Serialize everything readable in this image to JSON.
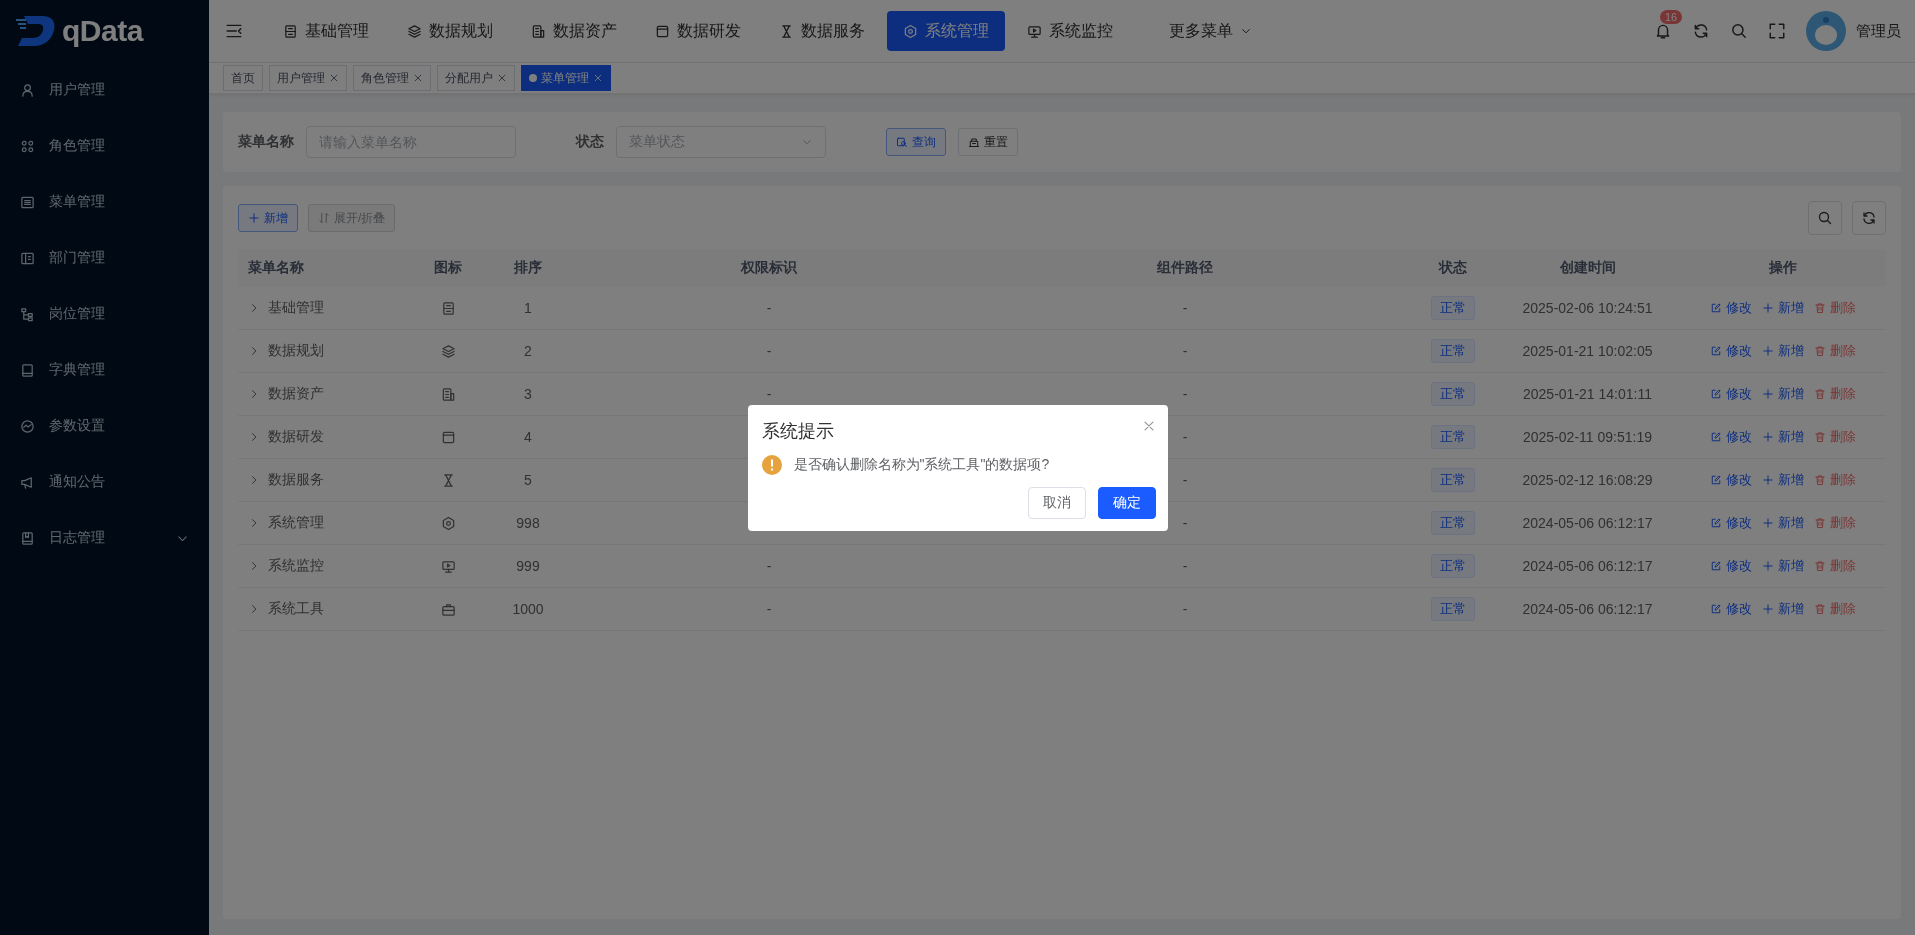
{
  "brand": {
    "name": "qData"
  },
  "sidebar": {
    "items": [
      {
        "label": "用户管理",
        "has_children": false
      },
      {
        "label": "角色管理",
        "has_children": false
      },
      {
        "label": "菜单管理",
        "has_children": false
      },
      {
        "label": "部门管理",
        "has_children": false
      },
      {
        "label": "岗位管理",
        "has_children": false
      },
      {
        "label": "字典管理",
        "has_children": false
      },
      {
        "label": "参数设置",
        "has_children": false
      },
      {
        "label": "通知公告",
        "has_children": false
      },
      {
        "label": "日志管理",
        "has_children": true
      }
    ]
  },
  "top_nav": {
    "items": [
      {
        "label": "基础管理",
        "selected": false
      },
      {
        "label": "数据规划",
        "selected": false
      },
      {
        "label": "数据资产",
        "selected": false
      },
      {
        "label": "数据研发",
        "selected": false
      },
      {
        "label": "数据服务",
        "selected": false
      },
      {
        "label": "系统管理",
        "selected": true
      },
      {
        "label": "系统监控",
        "selected": false
      }
    ],
    "more": "更多菜单"
  },
  "header_right": {
    "notification_count": "16",
    "user_name": "管理员"
  },
  "tabs": [
    {
      "label": "首页",
      "closable": false,
      "selected": false
    },
    {
      "label": "用户管理",
      "closable": true,
      "selected": false
    },
    {
      "label": "角色管理",
      "closable": true,
      "selected": false
    },
    {
      "label": "分配用户",
      "closable": true,
      "selected": false
    },
    {
      "label": "菜单管理",
      "closable": true,
      "selected": true
    }
  ],
  "filter": {
    "fields": [
      {
        "kind": "input",
        "label": "菜单名称",
        "placeholder": "请输入菜单名称"
      },
      {
        "kind": "select",
        "label": "状态",
        "placeholder": "菜单状态"
      }
    ],
    "buttons": [
      "查询",
      "重置"
    ]
  },
  "toolbar": {
    "add": "新增",
    "toggle": "展开/折叠"
  },
  "table": {
    "columns": [
      "菜单名称",
      "图标",
      "排序",
      "权限标识",
      "组件路径",
      "状态",
      "创建时间",
      "操作"
    ],
    "rows": [
      {
        "name": "基础管理",
        "sort": "1",
        "perms": "-",
        "path": "-",
        "status": "正常",
        "created": "2025-02-06 10:24:51",
        "actions": [
          "修改",
          "新增",
          "删除"
        ]
      },
      {
        "name": "数据规划",
        "sort": "2",
        "perms": "-",
        "path": "-",
        "status": "正常",
        "created": "2025-01-21 10:02:05",
        "actions": [
          "修改",
          "新增",
          "删除"
        ]
      },
      {
        "name": "数据资产",
        "sort": "3",
        "perms": "-",
        "path": "-",
        "status": "正常",
        "created": "2025-01-21 14:01:11",
        "actions": [
          "修改",
          "新增",
          "删除"
        ]
      },
      {
        "name": "数据研发",
        "sort": "4",
        "path": "-",
        "status": "正常",
        "created": "2025-02-11 09:51:19",
        "actions": [
          "修改",
          "新增",
          "删除"
        ]
      },
      {
        "name": "数据服务",
        "sort": "5",
        "path": "-",
        "status": "正常",
        "created": "2025-02-12 16:08:29",
        "actions": [
          "修改",
          "新增",
          "删除"
        ]
      },
      {
        "name": "系统管理",
        "sort": "998",
        "path": "-",
        "status": "正常",
        "created": "2024-05-06 06:12:17",
        "actions": [
          "修改",
          "新增",
          "删除"
        ]
      },
      {
        "name": "系统监控",
        "sort": "999",
        "perms": "-",
        "path": "-",
        "status": "正常",
        "created": "2024-05-06 06:12:17",
        "actions": [
          "修改",
          "新增",
          "删除"
        ]
      },
      {
        "name": "系统工具",
        "sort": "1000",
        "perms": "-",
        "path": "-",
        "status": "正常",
        "created": "2024-05-06 06:12:17",
        "actions": [
          "修改",
          "新增",
          "删除"
        ]
      }
    ]
  },
  "dialog": {
    "title": "系统提示",
    "message": "是否确认删除名称为\"系统工具\"的数据项?",
    "buttons": [
      "取消",
      "确定"
    ]
  }
}
